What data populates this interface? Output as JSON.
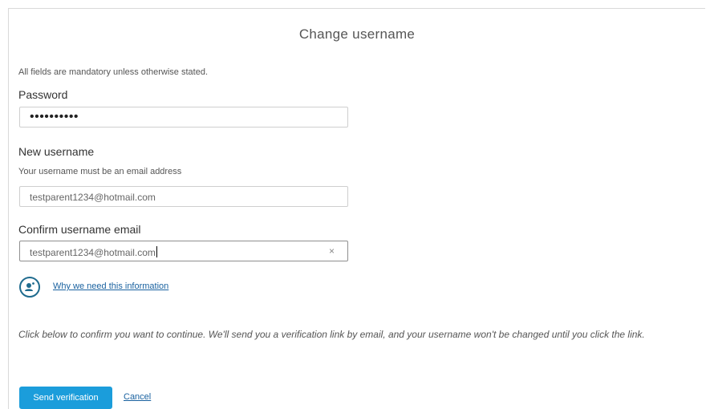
{
  "form": {
    "title": "Change username",
    "mandatory_note": "All fields are mandatory unless otherwise stated.",
    "password": {
      "label": "Password",
      "value": "••••••••••"
    },
    "new_username": {
      "label": "New username",
      "hint": "Your username must be an email address",
      "value": "testparent1234@hotmail.com"
    },
    "confirm_username": {
      "label": "Confirm username email",
      "value": "testparent1234@hotmail.com",
      "clear_symbol": "×"
    },
    "why_link": "Why we need this information",
    "confirm_note": "Click below to confirm you want to continue. We'll send you a verification link by email, and your username won't be changed until you click the link.",
    "send_button": "Send verification",
    "cancel_link": "Cancel"
  },
  "colors": {
    "primary_button": "#1b9ddb",
    "link": "#1a62a0",
    "info_icon": "#1f6b8e"
  },
  "icons": {
    "info": "person-info-icon",
    "clear": "clear-icon"
  }
}
